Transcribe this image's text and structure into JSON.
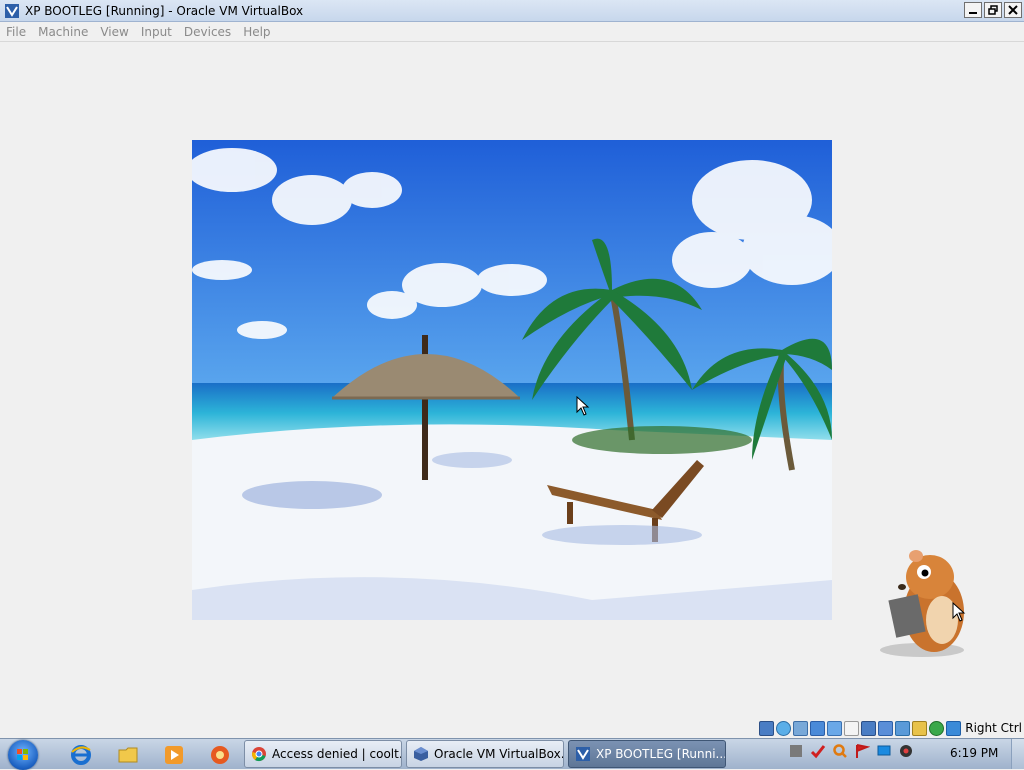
{
  "window": {
    "title": "XP BOOTLEG [Running] - Oracle VM VirtualBox",
    "controls": [
      "minimize",
      "restore",
      "close"
    ]
  },
  "menu": [
    "File",
    "Machine",
    "View",
    "Input",
    "Devices",
    "Help"
  ],
  "statusbar": {
    "icons": [
      "hard-disk-icon",
      "optical-drive-icon",
      "audio-icon",
      "network-icon",
      "usb-icon",
      "shared-folders-icon",
      "display-icon",
      "recording-icon",
      "capture-icon",
      "mouse-integration-icon",
      "keyboard-icon",
      "host-key-arrow-icon"
    ],
    "host_key": "Right Ctrl"
  },
  "taskbar": {
    "quick_launch": [
      "internet-explorer-icon",
      "explorer-folder-icon",
      "media-player-icon",
      "app-icon"
    ],
    "tasks": [
      {
        "label": "Access denied | coolt...",
        "icon": "chrome-icon",
        "active": false
      },
      {
        "label": "Oracle VM VirtualBox...",
        "icon": "virtualbox-icon",
        "active": false
      },
      {
        "label": "XP BOOTLEG [Runni...",
        "icon": "virtualbox-vm-icon",
        "active": true
      }
    ],
    "tray_icons": [
      "tray-app-icon",
      "tray-check-icon",
      "tray-search-icon",
      "tray-flag-icon",
      "tray-network-icon",
      "tray-volume-icon"
    ],
    "clock": "6:19 PM"
  },
  "colors": {
    "title_gradient_top": "#dbe6f4",
    "menu_disabled": "#8a8a8a",
    "taskbar_active": "#6a82a3"
  }
}
